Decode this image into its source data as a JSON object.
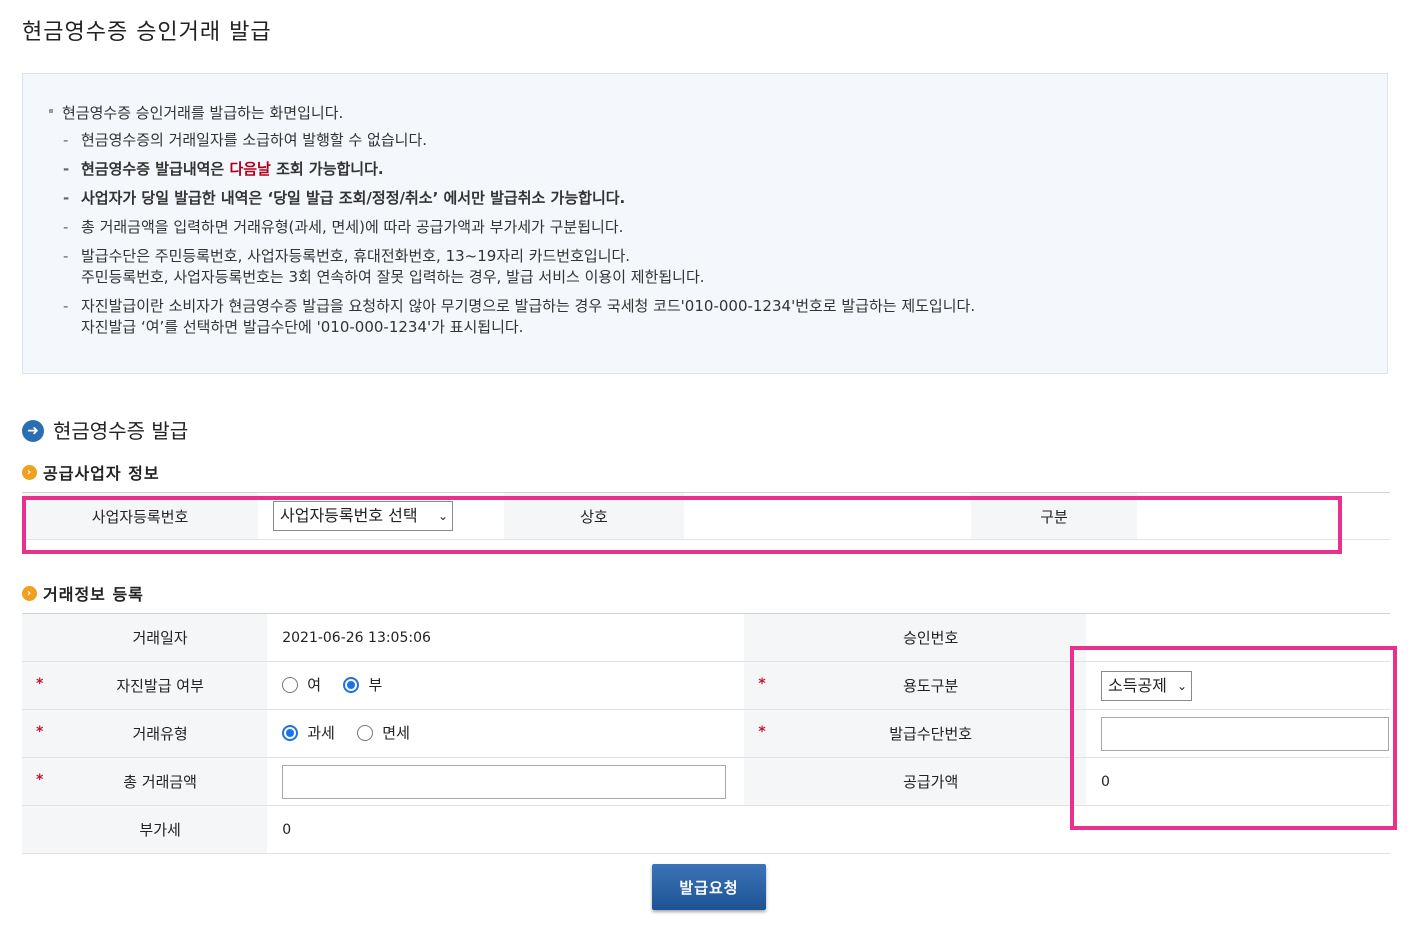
{
  "page_title": "현금영수증 승인거래 발급",
  "notice": {
    "header": "현금영수증 승인거래를 발급하는 화면입니다.",
    "items": [
      {
        "text": "현금영수증의 거래일자를 소급하여 발행할 수 없습니다."
      },
      {
        "pre": "현금영수증 발급내역은 ",
        "highlight": "다음날",
        "post": " 조회 가능합니다."
      },
      {
        "text": "사업자가 당일 발급한 내역은 ‘당일 발급 조회/정정/취소’ 에서만 발급취소 가능합니다."
      },
      {
        "text": "총 거래금액을 입력하면 거래유형(과세, 면세)에 따라 공급가액과 부가세가 구분됩니다."
      },
      {
        "line1": "발급수단은 주민등록번호, 사업자등록번호, 휴대전화번호, 13~19자리 카드번호입니다.",
        "line2": "주민등록번호, 사업자등록번호는 3회 연속하여 잘못 입력하는 경우, 발급 서비스 이용이 제한됩니다."
      },
      {
        "line1": "자진발급이란 소비자가 현금영수증 발급을 요청하지 않아 무기명으로 발급하는 경우 국세청 코드'010-000-1234'번호로 발급하는 제도입니다.",
        "line2": "자진발급 ‘여’를 선택하면 발급수단에 '010-000-1234'가 표시됩니다."
      }
    ]
  },
  "section_title": "현금영수증 발급",
  "supplier": {
    "title": "공급사업자 정보",
    "biz_no_label": "사업자등록번호",
    "biz_no_select": "사업자등록번호 선택",
    "company_label": "상호",
    "company_value": "",
    "type_label": "구분",
    "type_value": ""
  },
  "transaction": {
    "title": "거래정보 등록",
    "date_label": "거래일자",
    "date_value": "2021-06-26 13:05:06",
    "approval_label": "승인번호",
    "approval_value": "",
    "self_issue_label": "자진발급 여부",
    "self_issue_options": [
      "여",
      "부"
    ],
    "self_issue_selected": "부",
    "usage_label": "용도구분",
    "usage_select": "소득공제",
    "type_label": "거래유형",
    "type_options": [
      "과세",
      "면세"
    ],
    "type_selected": "과세",
    "id_number_label": "발급수단번호",
    "id_number_value": "",
    "total_label": "총 거래금액",
    "total_value": "",
    "supply_label": "공급가액",
    "supply_value": "0",
    "vat_label": "부가세",
    "vat_value": "0"
  },
  "submit_label": "발급요청",
  "colors": {
    "highlight_box": "#e8308c",
    "button": "#2b65a8",
    "required": "#c8102e",
    "red_text": "#b0001a"
  }
}
